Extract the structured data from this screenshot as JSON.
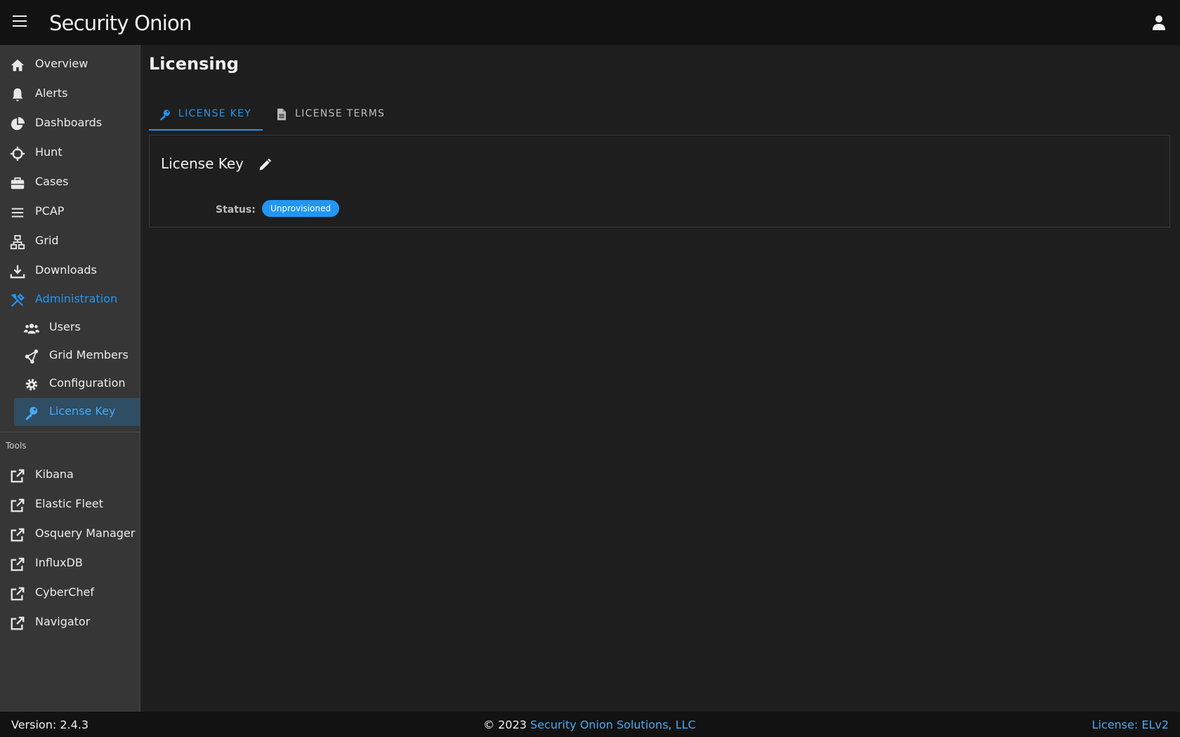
{
  "app": {
    "logo_text": "Security Onion",
    "accent_color": "#2196f3"
  },
  "page": {
    "title": "Licensing"
  },
  "sidebar": {
    "items": [
      {
        "label": "Overview",
        "icon": "home-icon"
      },
      {
        "label": "Alerts",
        "icon": "bell-icon"
      },
      {
        "label": "Dashboards",
        "icon": "pie-chart-icon"
      },
      {
        "label": "Hunt",
        "icon": "crosshairs-icon"
      },
      {
        "label": "Cases",
        "icon": "briefcase-icon"
      },
      {
        "label": "PCAP",
        "icon": "lines-icon"
      },
      {
        "label": "Grid",
        "icon": "network-icon"
      },
      {
        "label": "Downloads",
        "icon": "download-icon"
      },
      {
        "label": "Administration",
        "icon": "tools-icon"
      }
    ],
    "admin_subitems": [
      {
        "label": "Users",
        "icon": "users-icon"
      },
      {
        "label": "Grid Members",
        "icon": "nodes-icon"
      },
      {
        "label": "Configuration",
        "icon": "gear-icon"
      },
      {
        "label": "License Key",
        "icon": "key-icon"
      }
    ],
    "tools_header": "Tools",
    "tools": [
      {
        "label": "Kibana",
        "icon": "external-link-icon"
      },
      {
        "label": "Elastic Fleet",
        "icon": "external-link-icon"
      },
      {
        "label": "Osquery Manager",
        "icon": "external-link-icon"
      },
      {
        "label": "InfluxDB",
        "icon": "external-link-icon"
      },
      {
        "label": "CyberChef",
        "icon": "external-link-icon"
      },
      {
        "label": "Navigator",
        "icon": "external-link-icon"
      }
    ]
  },
  "tabs": [
    {
      "label": "LICENSE KEY",
      "icon": "key-icon",
      "active": true
    },
    {
      "label": "LICENSE TERMS",
      "icon": "document-icon",
      "active": false
    }
  ],
  "card": {
    "title": "License Key",
    "status_label": "Status:",
    "status_value": "Unprovisioned"
  },
  "footer": {
    "version": "Version: 2.4.3",
    "copyright": "© 2023",
    "company": "Security Onion Solutions, LLC",
    "license": "License: ELv2"
  }
}
